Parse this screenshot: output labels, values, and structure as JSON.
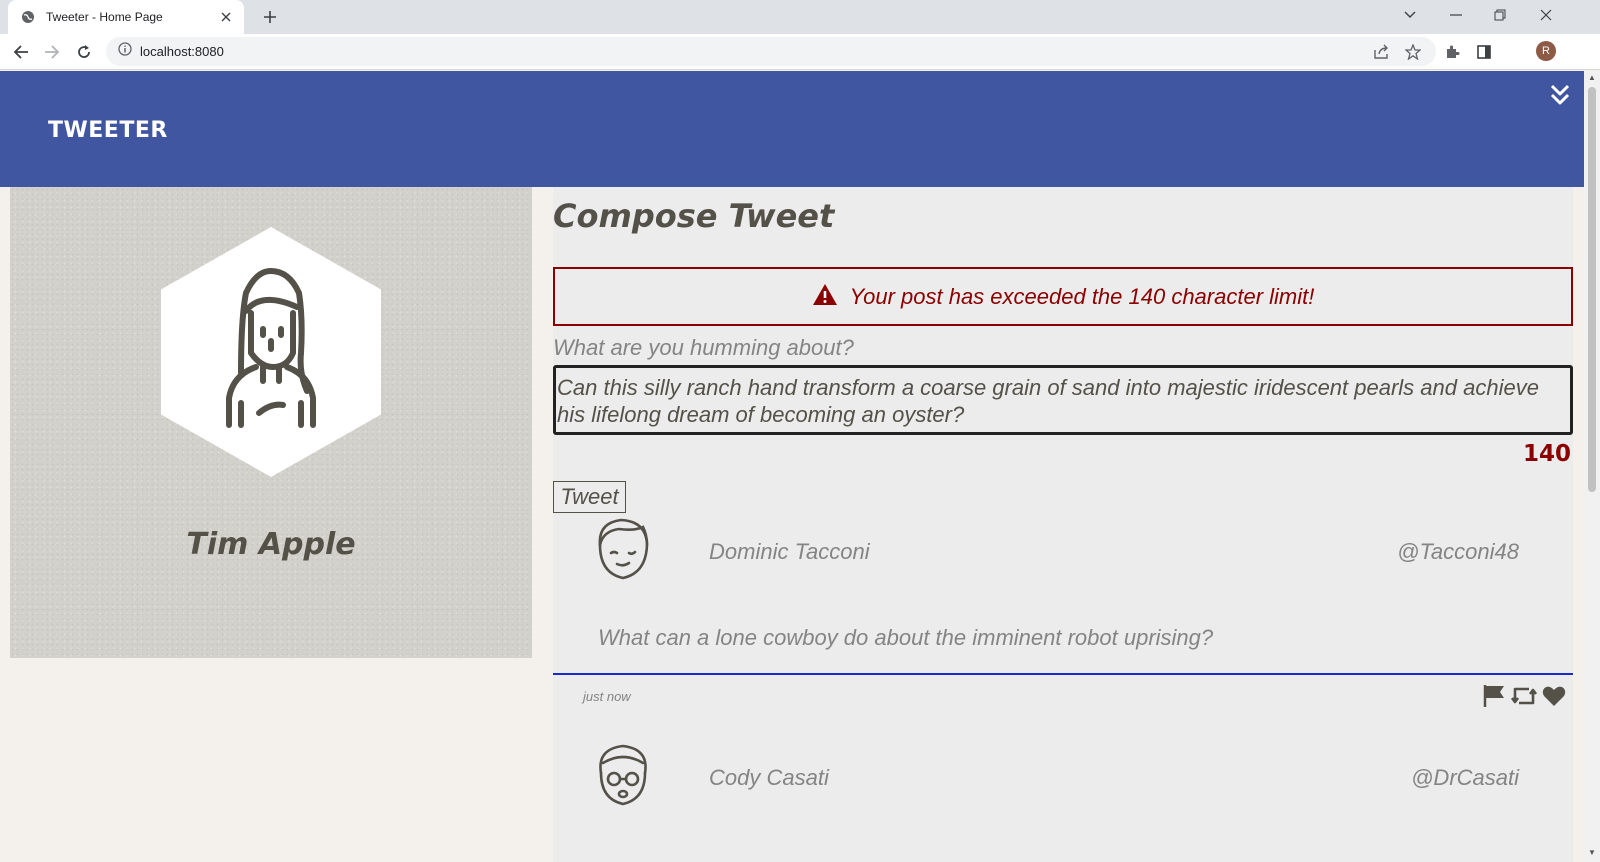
{
  "browser": {
    "tab_title": "Tweeter - Home Page",
    "url": "localhost:8080",
    "profile_initial": "R"
  },
  "header": {
    "logo": "TWEETER"
  },
  "profile": {
    "name": "Tim Apple"
  },
  "compose": {
    "title": "Compose Tweet",
    "error_message": "Your post has exceeded the 140 character limit!",
    "label": "What are you humming about?",
    "input_value": "Can this silly ranch hand transform a coarse grain of sand into majestic iridescent pearls and achieve his lifelong dream of becoming an oyster?",
    "counter": "140",
    "button_label": "Tweet"
  },
  "tweets": [
    {
      "author": "Dominic Tacconi",
      "handle": "@Tacconi48",
      "content": "What can a lone cowboy do about the imminent robot uprising?",
      "time": "just now"
    },
    {
      "author": "Cody Casati",
      "handle": "@DrCasati"
    }
  ],
  "colors": {
    "header_bg": "#4056a1",
    "error": "#8b0000",
    "divider": "#1d2acb",
    "text": "#545149",
    "muted": "#848484"
  }
}
